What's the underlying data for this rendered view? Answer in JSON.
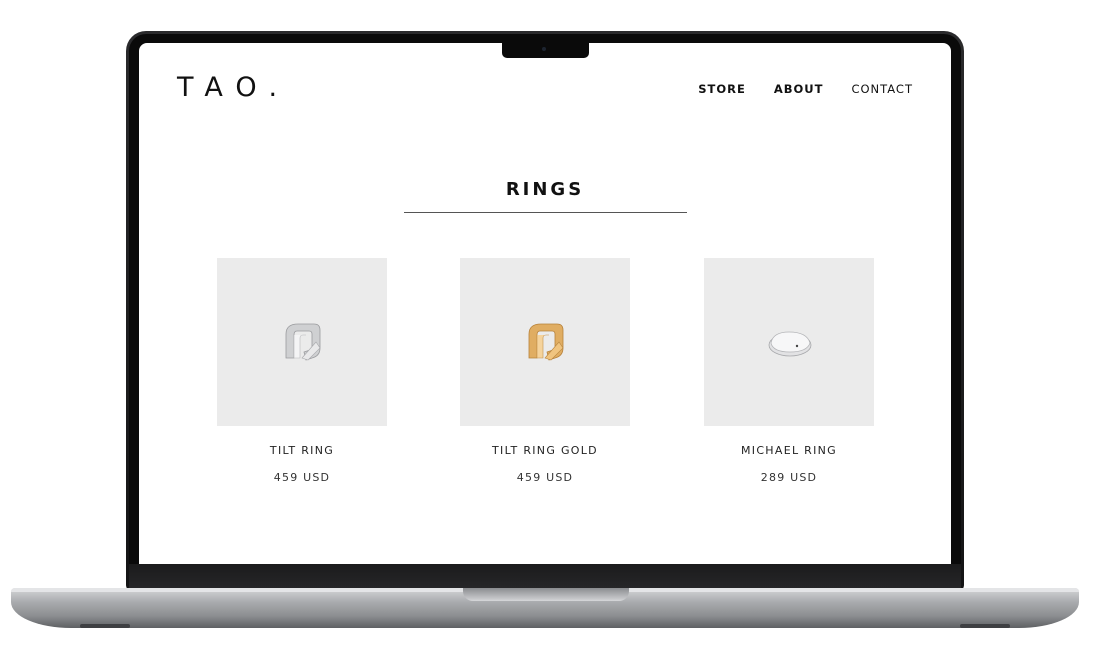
{
  "site": {
    "logo": "TAO."
  },
  "nav": {
    "items": [
      {
        "label": "STORE"
      },
      {
        "label": "ABOUT"
      },
      {
        "label": "CONTACT"
      }
    ]
  },
  "section": {
    "title": "RINGS"
  },
  "products": [
    {
      "name": "TILT RING",
      "price": "459 USD",
      "finish": "silver",
      "color": "#d6d7d9"
    },
    {
      "name": "TILT RING GOLD",
      "price": "459 USD",
      "finish": "gold",
      "color": "#e2b572"
    },
    {
      "name": "MICHAEL RING",
      "price": "289 USD",
      "finish": "silver",
      "color": "#dcdcde"
    }
  ],
  "colors": {
    "product_bg": "#ebebeb",
    "text": "#111111"
  }
}
